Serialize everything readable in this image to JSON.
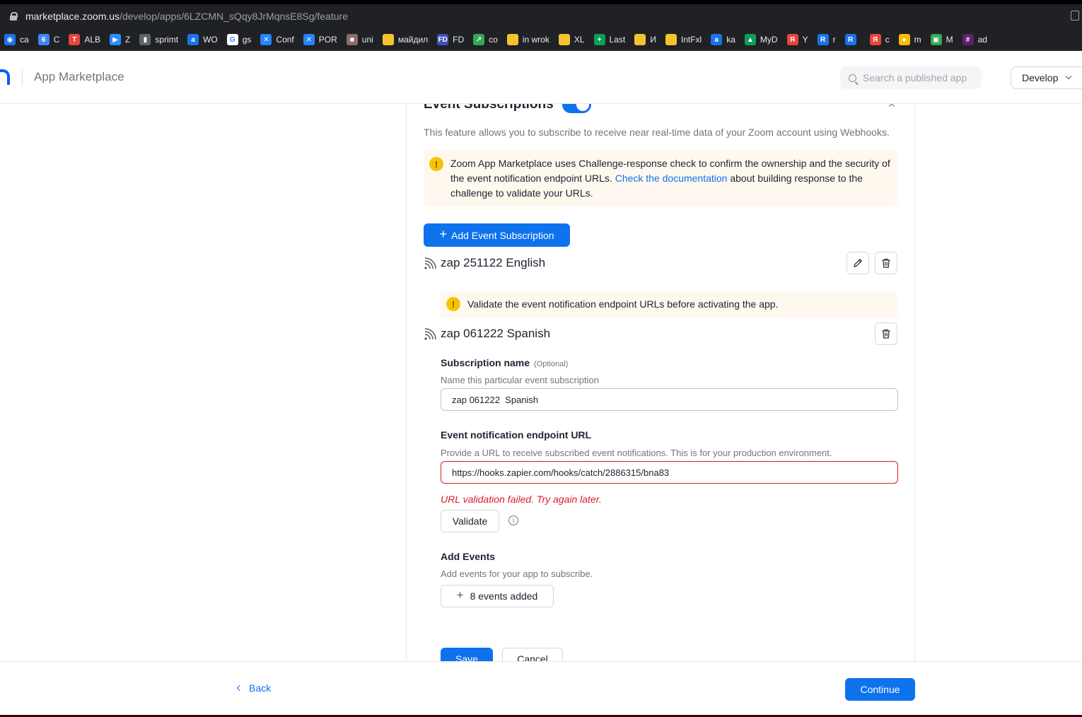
{
  "browser": {
    "url_host": "marketplace.zoom.us",
    "url_path": "/develop/apps/6LZCMN_sQqy8JrMqnsE8Sg/feature",
    "bookmarks": [
      {
        "label": "ca",
        "color": "#1a73e8",
        "glyph": "◉"
      },
      {
        "label": "C",
        "color": "#4285f4",
        "glyph": "6"
      },
      {
        "label": "ALB",
        "color": "#e8453c",
        "glyph": "T"
      },
      {
        "label": "Z",
        "color": "#2d8cff",
        "glyph": "▶"
      },
      {
        "label": "sprimt",
        "color": "#5f6368",
        "glyph": "▮"
      },
      {
        "label": "WO",
        "color": "#1a73e8",
        "glyph": "a"
      },
      {
        "label": "gs",
        "color": "#ffffff",
        "glyph": "G"
      },
      {
        "label": "Conf",
        "color": "#2684ff",
        "glyph": "✕"
      },
      {
        "label": "POR",
        "color": "#2684ff",
        "glyph": "✕"
      },
      {
        "label": "uni",
        "color": "#8d6e63",
        "glyph": "☻"
      },
      {
        "label": "майдил",
        "color": "#f4c430",
        "glyph": ""
      },
      {
        "label": "FD",
        "color": "#3f51b5",
        "glyph": "FD"
      },
      {
        "label": "co",
        "color": "#34a853",
        "glyph": "↗"
      },
      {
        "label": "in wrok",
        "color": "#f4c430",
        "glyph": ""
      },
      {
        "label": "XL",
        "color": "#f4c430",
        "glyph": ""
      },
      {
        "label": "Last",
        "color": "#0f9d58",
        "glyph": "+"
      },
      {
        "label": "И",
        "color": "#f4c430",
        "glyph": ""
      },
      {
        "label": "IntFxl",
        "color": "#f4c430",
        "glyph": ""
      },
      {
        "label": "ka",
        "color": "#1a73e8",
        "glyph": "a"
      },
      {
        "label": "MyD",
        "color": "#0f9d58",
        "glyph": "▲"
      },
      {
        "label": "Y",
        "color": "#e8453c",
        "glyph": "Я"
      },
      {
        "label": "r",
        "color": "#1a73e8",
        "glyph": "R"
      },
      {
        "label": "",
        "color": "#1a73e8",
        "glyph": "R"
      },
      {
        "label": "c",
        "color": "#e8453c",
        "glyph": "Я"
      },
      {
        "label": "m",
        "color": "#fbbc05",
        "glyph": "●"
      },
      {
        "label": "M",
        "color": "#34a853",
        "glyph": "▣"
      },
      {
        "label": "ad",
        "color": "#611f69",
        "glyph": "#"
      }
    ]
  },
  "header": {
    "title": "App Marketplace",
    "search_placeholder": "Search a published app",
    "develop_label": "Develop"
  },
  "event_subscriptions": {
    "title": "Event Subscriptions",
    "close_glyph": "✕",
    "description": "This feature allows you to subscribe to receive near real-time data of your Zoom account using Webhooks.",
    "banner_part1": "Zoom App Marketplace uses Challenge-response check to confirm the ownership and the security of the event notification endpoint URLs. ",
    "banner_link": "Check the documentation",
    "banner_part2": " about building response to the challenge to validate your URLs.",
    "warn_glyph": "!",
    "add_button": "Add Event Subscription",
    "add_glyph": "+"
  },
  "subscriptions": [
    {
      "name": "zap 251122 English",
      "warning": "Validate the event notification endpoint URLs before activating the app."
    },
    {
      "name": "zap 061222 Spanish"
    }
  ],
  "form": {
    "sub_name_label": "Subscription name",
    "sub_name_optional": "(Optional)",
    "sub_name_help": "Name this particular event subscription",
    "sub_name_value": "zap 061222  Spanish",
    "endpoint_label": "Event notification endpoint URL",
    "endpoint_help": "Provide a URL to receive subscribed event notifications. This is for your production environment.",
    "endpoint_value": "https://hooks.zapier.com/hooks/catch/2886315/bna83",
    "endpoint_error": "URL validation failed. Try again later.",
    "validate_button": "Validate",
    "info_glyph": "i",
    "add_events_label": "Add Events",
    "add_events_help": "Add events for your app to subscribe.",
    "events_added_glyph": "+",
    "events_added": "8 events added",
    "save_button": "Save",
    "cancel_button": "Cancel"
  },
  "footer": {
    "back_label": "Back",
    "continue_label": "Continue"
  },
  "colors": {
    "primary": "#0e72ed",
    "error": "#d91c2c",
    "warning_bg": "#fef8ef",
    "warning_icon": "#f5c400"
  }
}
